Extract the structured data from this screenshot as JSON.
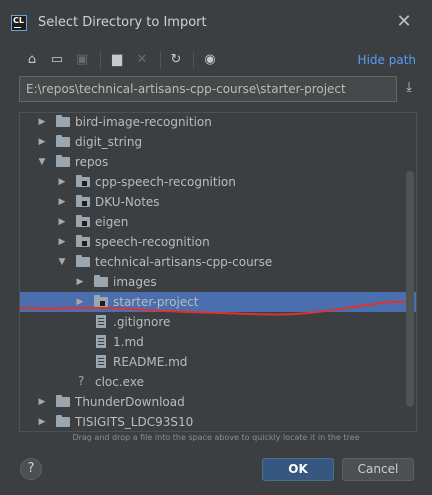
{
  "window": {
    "title": "Select Directory to Import",
    "close_glyph": "✕"
  },
  "toolbar": {
    "buttons": [
      {
        "icon": "home-icon",
        "glyph": "⌂"
      },
      {
        "icon": "desktop-icon",
        "glyph": "▭"
      },
      {
        "icon": "project-icon",
        "glyph": "▣",
        "disabled": true
      },
      {
        "icon": "new-folder-icon",
        "glyph": "▆"
      },
      {
        "icon": "delete-icon",
        "glyph": "✕",
        "disabled": true
      },
      {
        "icon": "refresh-icon",
        "glyph": "↻"
      },
      {
        "icon": "show-hidden-icon",
        "glyph": "◉"
      }
    ],
    "hide_path_label": "Hide path"
  },
  "path": {
    "value": "E:\\repos\\technical-artisans-cpp-course\\starter-project"
  },
  "tree": {
    "rows": [
      {
        "label": "bird-image-recognition",
        "level": 1,
        "type": "folder",
        "expand": "collapsed"
      },
      {
        "label": "digit_string",
        "level": 1,
        "type": "folder",
        "expand": "collapsed"
      },
      {
        "label": "repos",
        "level": 1,
        "type": "folder",
        "expand": "expanded"
      },
      {
        "label": "cpp-speech-recognition",
        "level": 2,
        "type": "folder-mod",
        "expand": "collapsed"
      },
      {
        "label": "DKU-Notes",
        "level": 2,
        "type": "folder-mod",
        "expand": "collapsed"
      },
      {
        "label": "eigen",
        "level": 2,
        "type": "folder-mod",
        "expand": "collapsed"
      },
      {
        "label": "speech-recognition",
        "level": 2,
        "type": "folder-mod",
        "expand": "collapsed"
      },
      {
        "label": "technical-artisans-cpp-course",
        "level": 2,
        "type": "folder",
        "expand": "expanded"
      },
      {
        "label": "images",
        "level": 3,
        "type": "folder",
        "expand": "collapsed"
      },
      {
        "label": "starter-project",
        "level": 3,
        "type": "folder-mod",
        "expand": "collapsed",
        "selected": true
      },
      {
        "label": ".gitignore",
        "level": 3,
        "type": "file",
        "expand": "none"
      },
      {
        "label": "1.md",
        "level": 3,
        "type": "file",
        "expand": "none"
      },
      {
        "label": "README.md",
        "level": 3,
        "type": "file",
        "expand": "none"
      },
      {
        "label": "cloc.exe",
        "level": 2,
        "type": "exe",
        "expand": "none"
      },
      {
        "label": "ThunderDownload",
        "level": 1,
        "type": "folder",
        "expand": "collapsed"
      },
      {
        "label": "TISIGITS_LDC93S10",
        "level": 1,
        "type": "folder",
        "expand": "collapsed"
      }
    ]
  },
  "hint": "Drag and drop a file into the space above to quickly locate it in the tree",
  "buttons": {
    "help": "?",
    "ok": "OK",
    "cancel": "Cancel"
  },
  "colors": {
    "selection": "#4b6eaf",
    "annotation": "#e0322b",
    "link": "#589df6"
  }
}
